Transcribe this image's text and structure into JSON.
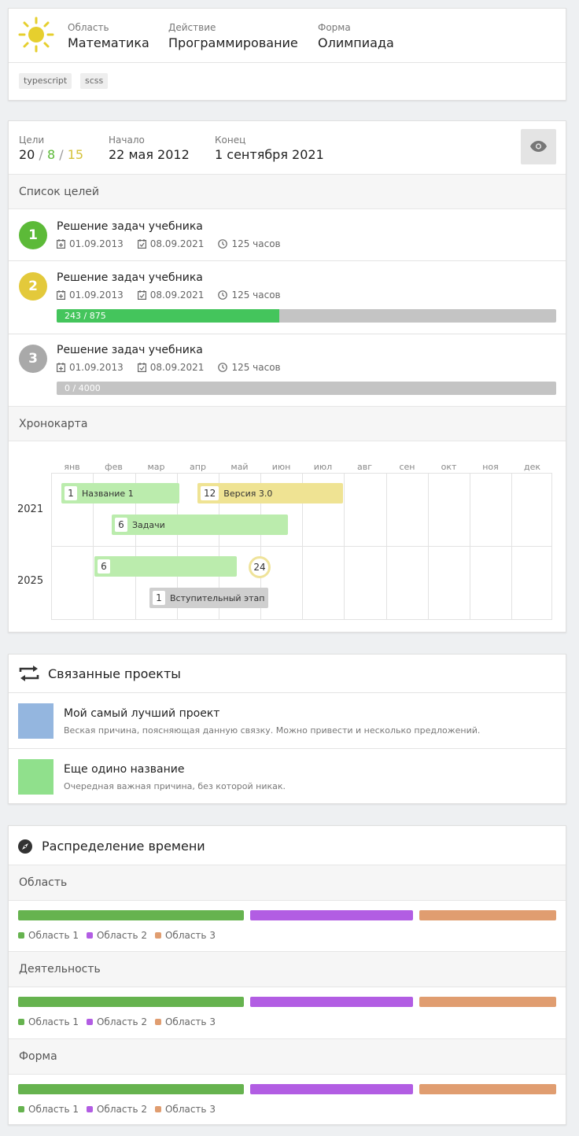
{
  "header": {
    "area_label": "Область",
    "area_value": "Математика",
    "action_label": "Действие",
    "action_value": "Программирование",
    "form_label": "Форма",
    "form_value": "Олимпиада",
    "tags": [
      "typescript",
      "scss"
    ]
  },
  "goals": {
    "targets_label": "Цели",
    "targets_total": "20",
    "targets_done": "8",
    "targets_progress": "15",
    "slash": "/",
    "start_label": "Начало",
    "start_value": "22 мая 2012",
    "end_label": "Конец",
    "end_value": "1 сентября 2021",
    "list_title": "Список целей",
    "items": [
      {
        "num": "1",
        "title": "Решение задач учебника",
        "start": "01.09.2013",
        "end": "08.09.2021",
        "hours": "125 часов",
        "color": "#5cba38"
      },
      {
        "num": "2",
        "title": "Решение задач учебника",
        "start": "01.09.2013",
        "end": "08.09.2021",
        "hours": "125 часов",
        "color": "#e3c93b",
        "progress_text": "243 / 875",
        "progress": 0.4457
      },
      {
        "num": "3",
        "title": "Решение задач учебника",
        "start": "01.09.2013",
        "end": "08.09.2021",
        "hours": "125 часов",
        "color": "#a9a9a9",
        "progress_text": "0  / 4000",
        "progress": 0
      }
    ]
  },
  "chrono": {
    "title": "Хронокарта",
    "months": [
      "янв",
      "фев",
      "мар",
      "апр",
      "май",
      "июн",
      "июл",
      "авг",
      "сен",
      "окт",
      "ноя",
      "дек"
    ],
    "years": [
      "2021",
      "2025"
    ],
    "bars": [
      {
        "num": "1",
        "label": "Название 1"
      },
      {
        "num": "12",
        "label": "Версия 3.0"
      },
      {
        "num": "6",
        "label": "Задачи"
      },
      {
        "num": "6",
        "label": ""
      },
      {
        "num": "1",
        "label": "Вступительный этап"
      }
    ],
    "milestone": "24",
    "colors": {
      "green": "#bbecad",
      "yellow": "#efe393",
      "gray": "#cfcfcf",
      "milestone_ring": "#efe39a"
    }
  },
  "related": {
    "title": "Связанные проекты",
    "items": [
      {
        "name": "Мой самый лучший проект",
        "desc": "Веская причина, поясняющая данную связку. Можно привести и несколько предложений.",
        "color": "#94b6df"
      },
      {
        "name": "Еще одино название",
        "desc": "Очередная важная причина, без которой никак.",
        "color": "#90e08c"
      }
    ]
  },
  "time": {
    "title": "Распределение времени",
    "sections": [
      {
        "title": "Область",
        "legend": [
          "Область 1",
          "Область 2",
          "Область 3"
        ]
      },
      {
        "title": "Деятельность",
        "legend": [
          "Область 1",
          "Область 2",
          "Область 3"
        ]
      },
      {
        "title": "Форма",
        "legend": [
          "Область 1",
          "Область 2",
          "Область 3"
        ]
      }
    ],
    "shares": [
      0.43,
      0.31,
      0.26
    ],
    "colors": [
      "#66b34f",
      "#b25de3",
      "#e09d70"
    ]
  }
}
